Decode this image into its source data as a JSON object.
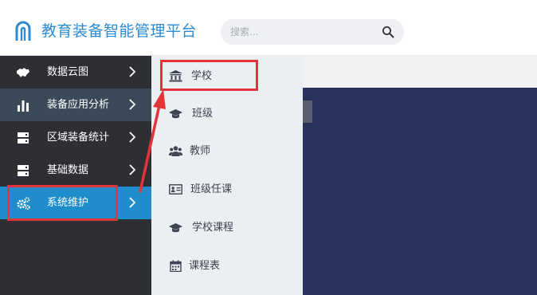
{
  "header": {
    "app_title": "教育装备智能管理平台",
    "logo_icon": "arch-logo-icon",
    "search": {
      "placeholder": "搜索...",
      "value": "",
      "icon": "search-icon"
    }
  },
  "sidebar": {
    "items": [
      {
        "label": "数据云图",
        "icon": "map-icon",
        "state": "normal"
      },
      {
        "label": "装备应用分析",
        "icon": "bar-chart-icon",
        "state": "hover"
      },
      {
        "label": "区域装备统计",
        "icon": "server-icon",
        "state": "normal"
      },
      {
        "label": "基础数据",
        "icon": "server-icon",
        "state": "normal"
      },
      {
        "label": "系统维护",
        "icon": "gears-icon",
        "state": "active"
      }
    ]
  },
  "submenu": {
    "items": [
      {
        "label": "学校",
        "icon": "institution-icon"
      },
      {
        "label": "班级",
        "icon": "graduation-cap-icon"
      },
      {
        "label": "教师",
        "icon": "users-icon"
      },
      {
        "label": "班级任课",
        "icon": "id-card-icon"
      },
      {
        "label": "学校课程",
        "icon": "graduation-cap-icon"
      },
      {
        "label": "课程表",
        "icon": "calendar-icon"
      }
    ]
  },
  "colors": {
    "brand": "#2c8ad0",
    "sidebar_bg": "#2d2f35",
    "sidebar_active": "#1f8ccb",
    "submenu_bg": "#eceff2",
    "main_bg": "#27335c",
    "annotation_red": "#e3343a"
  }
}
